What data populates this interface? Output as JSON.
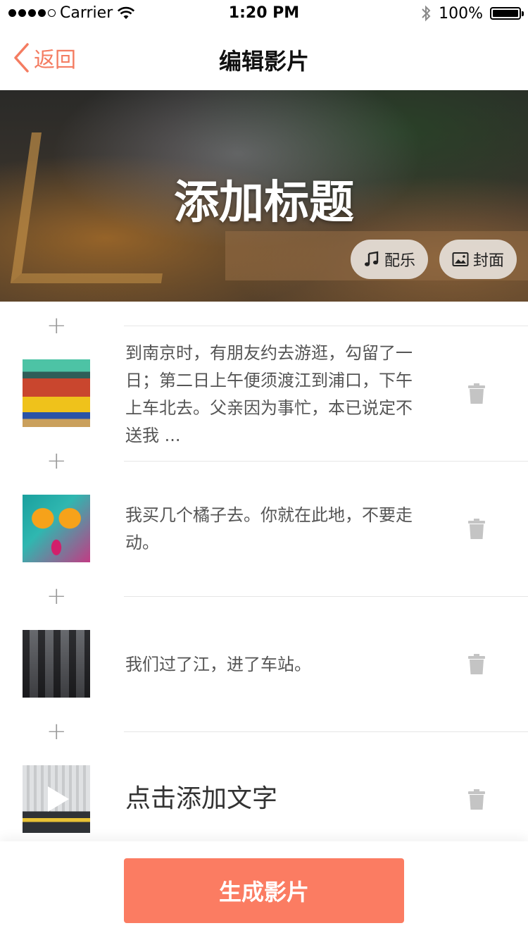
{
  "status_bar": {
    "carrier": "Carrier",
    "time": "1:20 PM",
    "battery": "100%"
  },
  "nav": {
    "back_label": "返回",
    "title": "编辑影片"
  },
  "hero": {
    "title": "添加标题",
    "music_label": "配乐",
    "cover_label": "封面"
  },
  "items": [
    {
      "text": "到南京时，有朋友约去游逛，勾留了一日；第二日上午便须渡江到浦口，下午上车北去。父亲因为事忙，本已说定不送我 ..."
    },
    {
      "text": "我买几个橘子去。你就在此地，不要走动。"
    },
    {
      "text": "我们过了江，进了车站。"
    },
    {
      "text": "点击添加文字"
    }
  ],
  "bottom": {
    "generate_label": "生成影片"
  },
  "colors": {
    "accent": "#f47c61",
    "button": "#fb7c62"
  }
}
